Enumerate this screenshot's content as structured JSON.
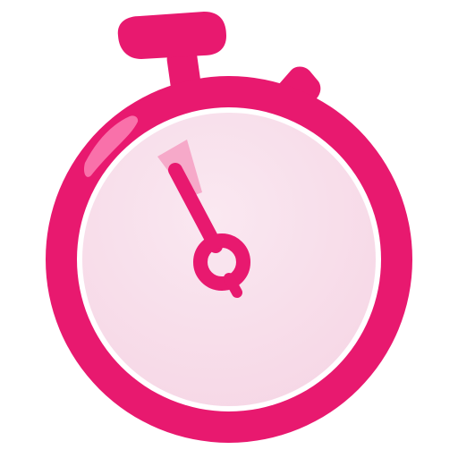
{
  "icon": {
    "name": "stopwatch-icon"
  },
  "colors": {
    "background": "#ffffff",
    "primary": "#e8196f",
    "primary_dark": "#d3145f",
    "face": "#f6d6e5",
    "face_inner": "#fae8f1",
    "face_ring": "#ffffff",
    "hand_wedge": "#f6a9c9",
    "highlight": "#ff8fbd"
  },
  "text": {}
}
